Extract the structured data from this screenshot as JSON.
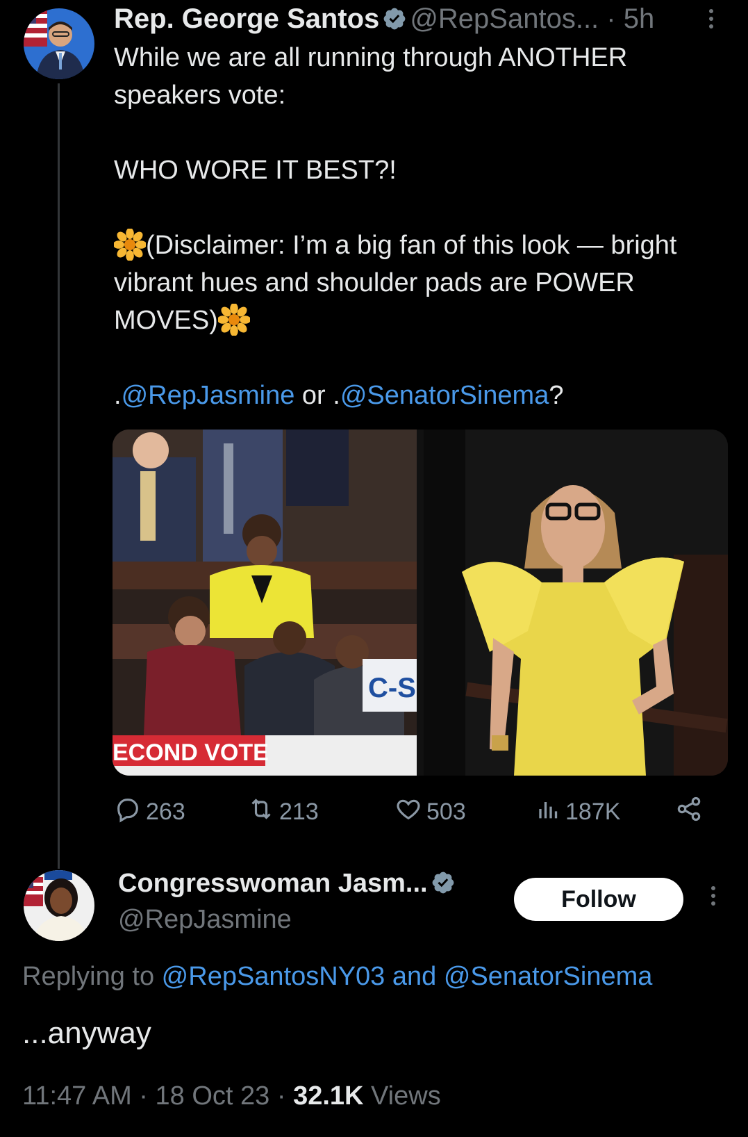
{
  "tweet": {
    "author_name": "Rep. George Santos",
    "author_handle": "@RepSantos...",
    "separator": "·",
    "time": "5h",
    "body_line1": "While we are all running through ANOTHER speakers vote:",
    "body_line2": "WHO WORE IT BEST?!",
    "body_line3": "(Disclaimer: I’m a big fan of this look — bright vibrant hues and shoulder pads are POWER MOVES)",
    "mention_prefix1": ".",
    "mention1": "@RepJasmine",
    "mention_mid": " or .",
    "mention2": "@SenatorSinema",
    "mention_suffix": "?",
    "media_left_caption": "ECOND VOTE",
    "media_left_logo": "C-S",
    "stats": {
      "replies": "263",
      "reposts": "213",
      "likes": "503",
      "views": "187K"
    }
  },
  "reply": {
    "author_name": "Congresswoman Jasm...",
    "author_handle": "@RepJasmine",
    "follow_label": "Follow",
    "replying_prefix": "Replying to ",
    "replying_to1": "@RepSantosNY03",
    "replying_and": " and ",
    "replying_to2": "@SenatorSinema",
    "text": "...anyway",
    "time": "11:47 AM",
    "dot": " · ",
    "date": "18 Oct 23",
    "views_count": "32.1K",
    "views_label": " Views"
  },
  "colors": {
    "background": "#000000",
    "text": "#e7e9ea",
    "link": "#4a99e9",
    "muted": "#71767b",
    "verified": "#829aab"
  },
  "icons": [
    "verified-badge-icon",
    "more-icon",
    "flower-emoji",
    "reply-icon",
    "repost-icon",
    "like-icon",
    "views-icon",
    "share-icon"
  ]
}
